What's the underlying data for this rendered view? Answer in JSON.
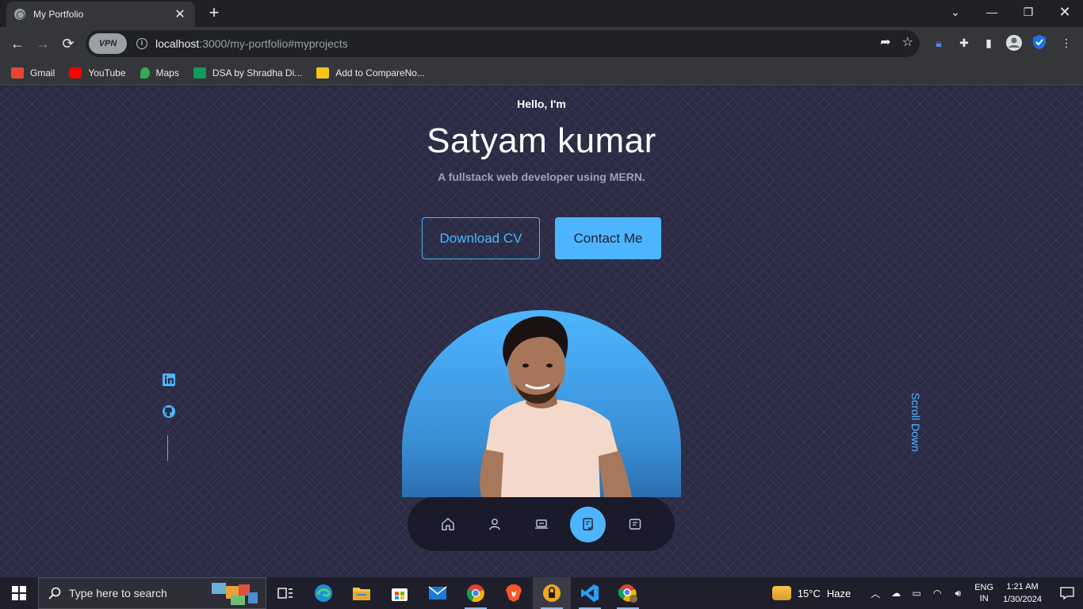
{
  "browser": {
    "tab_title": "My Portfolio",
    "tab_close": "✕",
    "new_tab": "+",
    "url_host": "localhost",
    "url_rest": ":3000/my-portfolio#myprojects",
    "vpn_label": "VPN",
    "bookmarks": [
      {
        "label": "Gmail",
        "color": "#ea4335"
      },
      {
        "label": "YouTube",
        "color": "#ff0000"
      },
      {
        "label": "Maps",
        "color": "#34a853"
      },
      {
        "label": "DSA by Shradha Di...",
        "color": "#0f9d58"
      },
      {
        "label": "Add to CompareNo...",
        "color": "#f5c518"
      }
    ]
  },
  "hero": {
    "greeting": "Hello, I'm",
    "name": "Satyam kumar",
    "tagline": "A fullstack web developer using MERN.",
    "download_cv": "Download CV",
    "contact_me": "Contact Me",
    "scroll_down": "Scroll Down"
  },
  "colors": {
    "accent": "#4db5ff",
    "background": "#2b2b45"
  },
  "nav": {
    "items": [
      {
        "icon": "home-icon",
        "active": false
      },
      {
        "icon": "user-icon",
        "active": false
      },
      {
        "icon": "laptop-icon",
        "active": false
      },
      {
        "icon": "projects-icon",
        "active": true
      },
      {
        "icon": "message-icon",
        "active": false
      }
    ]
  },
  "taskbar": {
    "search_placeholder": "Type here to search",
    "temperature": "15°C",
    "weather": "Haze",
    "lang_top": "ENG",
    "lang_bottom": "IN",
    "time": "1:21 AM",
    "date": "1/30/2024"
  }
}
